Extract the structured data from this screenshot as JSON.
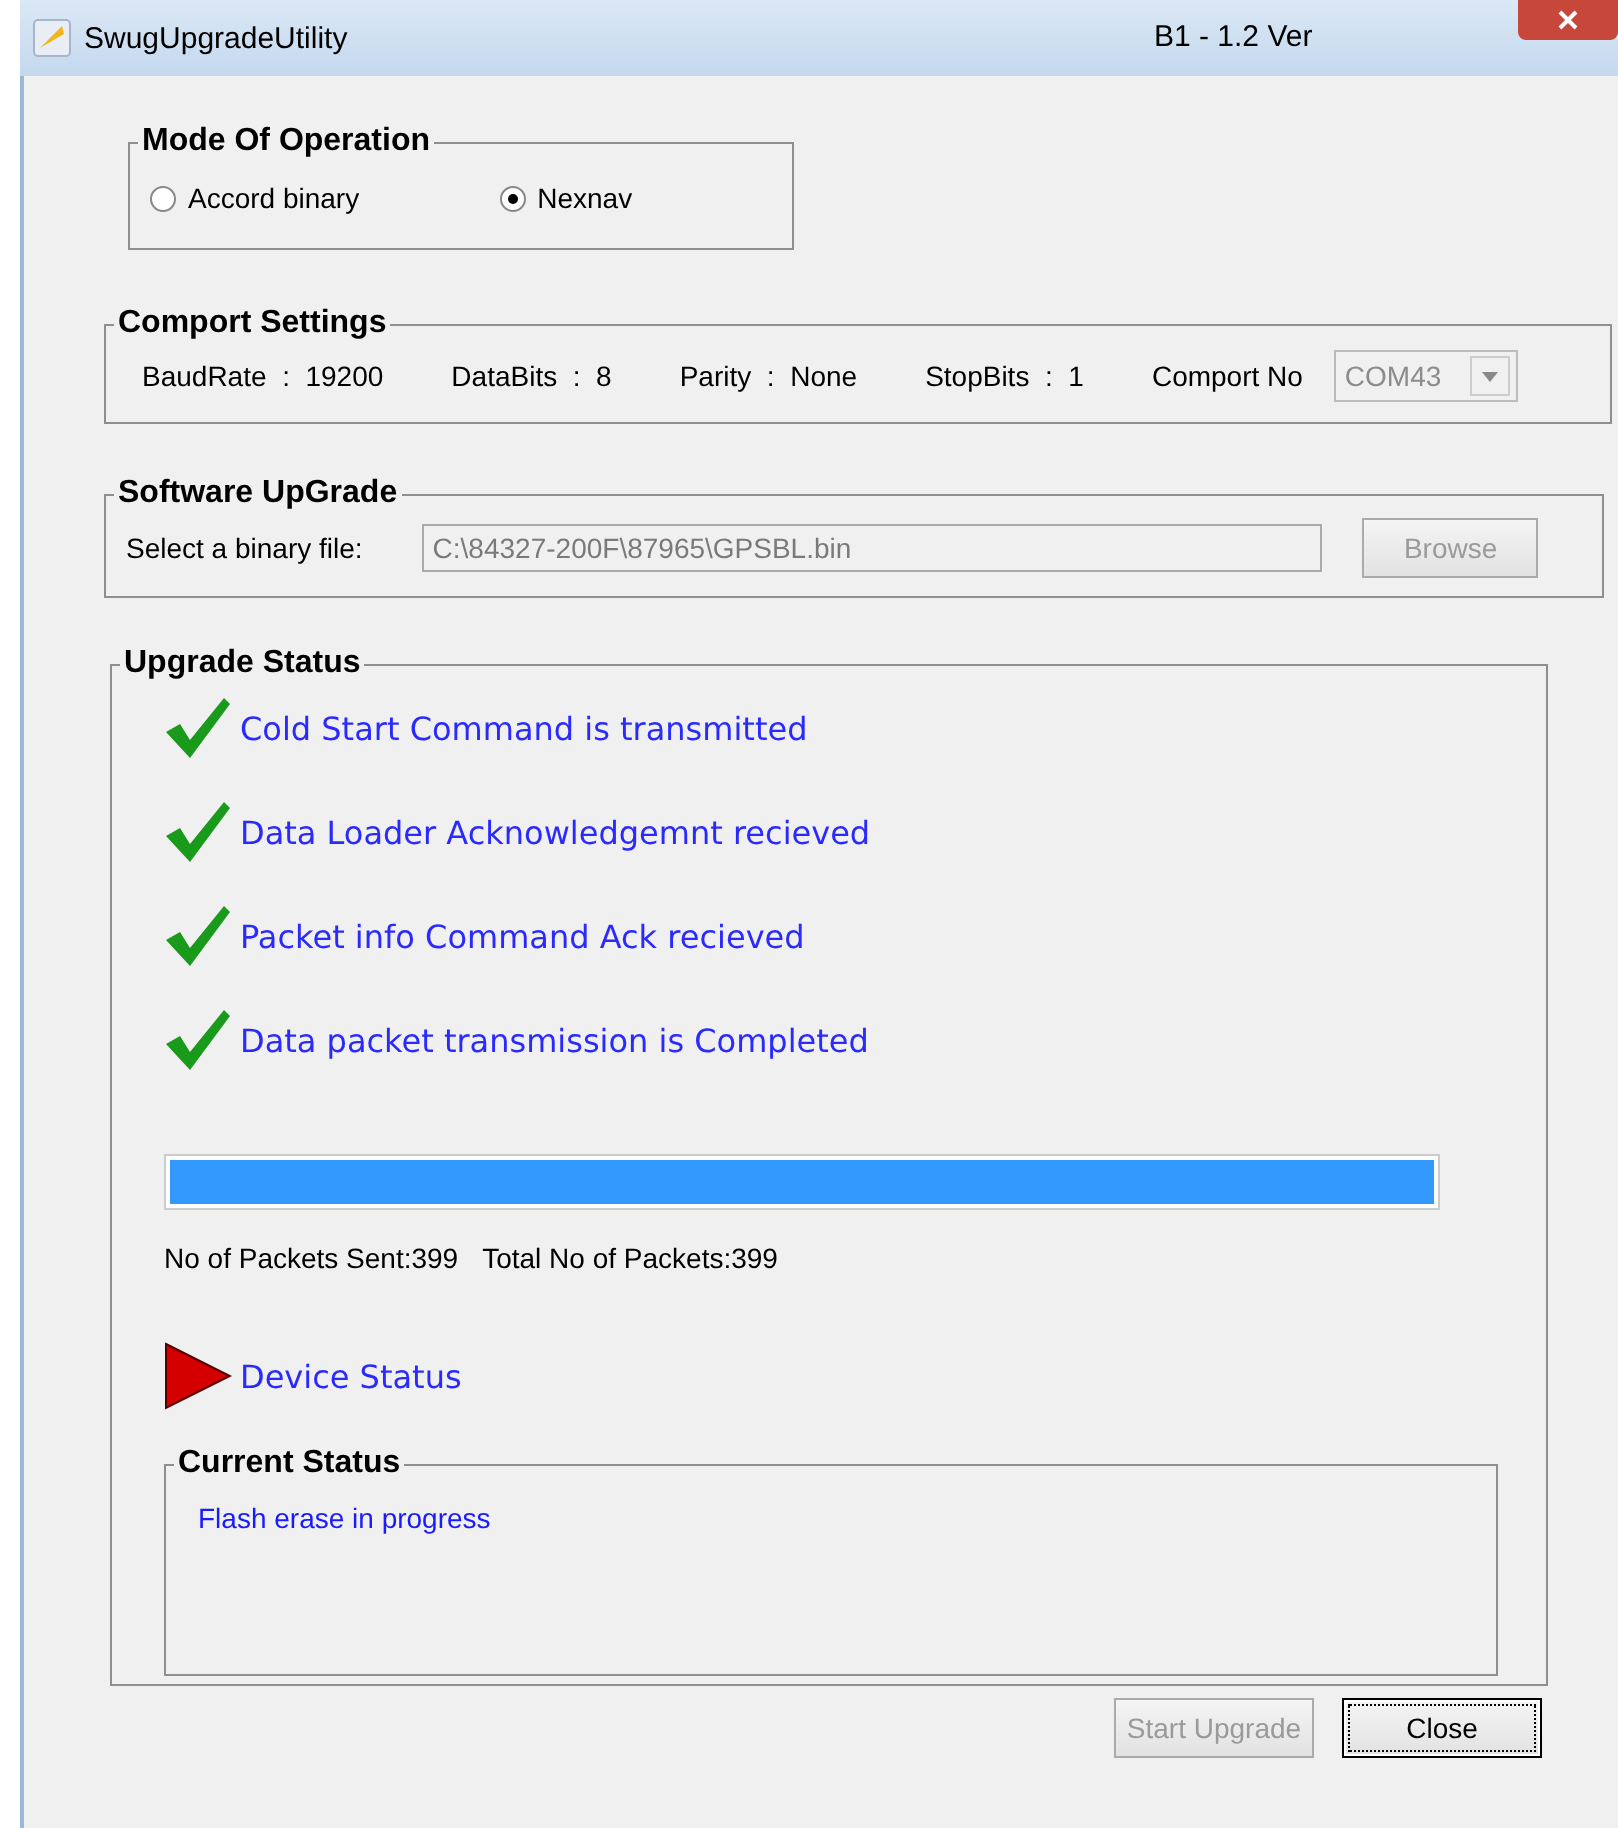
{
  "window": {
    "title": "SwugUpgradeUtility",
    "version": "B1  -  1.2 Ver"
  },
  "mode": {
    "title": "Mode Of Operation",
    "options": [
      {
        "label": "Accord binary",
        "selected": false
      },
      {
        "label": "Nexnav",
        "selected": true
      }
    ]
  },
  "comport": {
    "title": "Comport Settings",
    "settings": [
      {
        "label": "BaudRate",
        "sep": ":",
        "value": "19200"
      },
      {
        "label": "DataBits",
        "sep": ":",
        "value": "8"
      },
      {
        "label": "Parity",
        "sep": ":",
        "value": "None"
      },
      {
        "label": "StopBits",
        "sep": ":",
        "value": "1"
      }
    ],
    "port_label": "Comport No",
    "port_value": "COM43",
    "port_disabled": true
  },
  "software": {
    "title": "Software UpGrade",
    "label": "Select a binary file:",
    "value": "C:\\84327-200F\\87965\\GPSBL.bin",
    "value_disabled": true,
    "browse": "Browse",
    "browse_disabled": true
  },
  "status": {
    "title": "Upgrade Status",
    "steps": [
      {
        "text": "Cold Start Command is transmitted",
        "done": true
      },
      {
        "text": "Data Loader Acknowledgemnt recieved",
        "done": true
      },
      {
        "text": "Packet info Command Ack recieved",
        "done": true
      },
      {
        "text": "Data packet transmission is Completed",
        "done": true
      }
    ],
    "progress": {
      "level": 1
    },
    "packets_sent": "No of Packets Sent:399",
    "packets_total": "Total No of Packets:399",
    "device_status": "Device Status",
    "current": {
      "title": "Current Status",
      "text": "Flash erase in progress"
    }
  },
  "buttons": [
    {
      "label": "Start Upgrade",
      "disabled": true,
      "focused": false
    },
    {
      "label": "Close",
      "disabled": false,
      "focused": true
    }
  ]
}
